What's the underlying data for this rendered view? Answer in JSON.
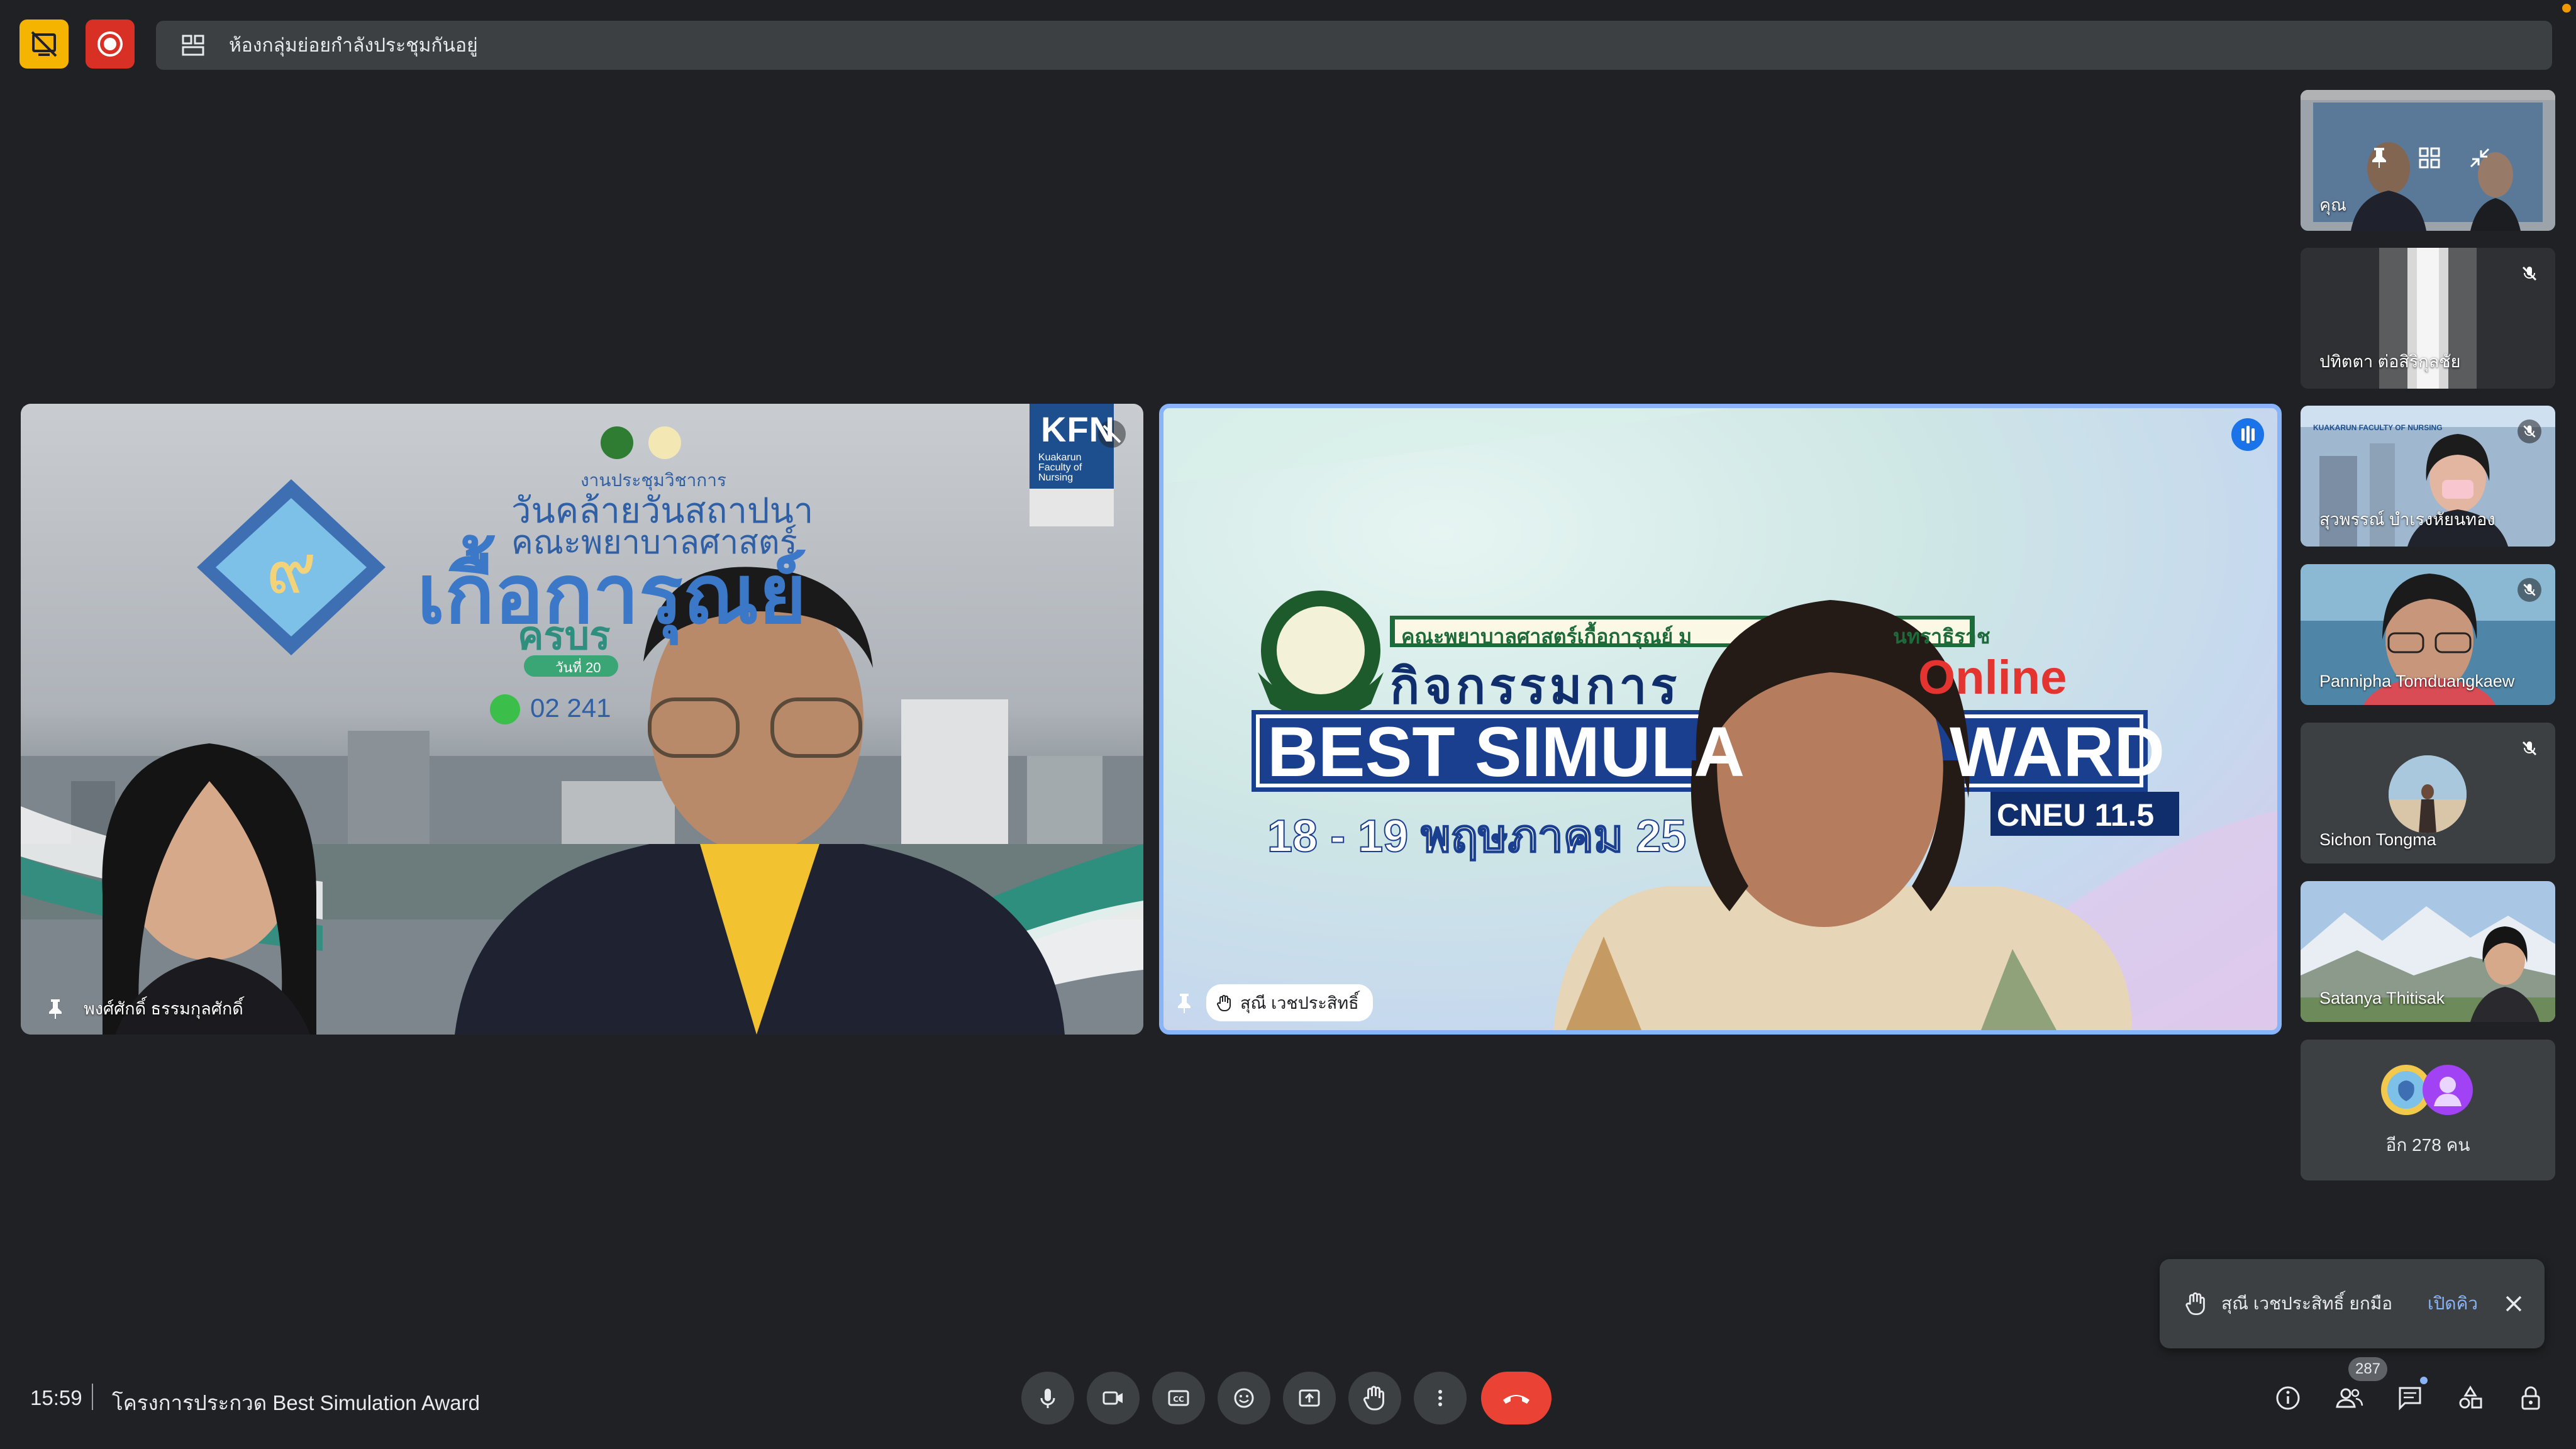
{
  "top_bar": {
    "breakout_notice": "ห้องกลุ่มย่อยกำลังประชุมกันอยู่"
  },
  "main_tiles": [
    {
      "participant_name": "พงศ์ศักดิ์ ธรรมกุลศักดิ์",
      "background": {
        "kfn_logo": "KFN",
        "kfn_sub": "Kuakarun Faculty of Nursing",
        "line1": "งานประชุมวิชาการ",
        "line2": "วันคล้ายวันสถาปนา",
        "line3": "คณะพยาบาลศาสตร์",
        "line4": "เกื้อการุณย์",
        "line5": "ครบร",
        "line6": "วันที่ 20",
        "phone": "02 241"
      }
    },
    {
      "participant_name": "สุณี เวชประสิทธิ์",
      "background": {
        "faculty": "คณะพยาบาลศาสตร์เกื้อการุณย์ ม",
        "faculty_tail": "นทราธิราช",
        "activity": "กิจกรรมการ",
        "online": "Online",
        "award": "BEST SIMULA",
        "award_tail": "WARD",
        "cneu": "CNEU 11.5",
        "date": "18 - 19 พฤษภาคม 25"
      }
    }
  ],
  "side_tiles": [
    {
      "name": "คุณ"
    },
    {
      "name": "ปทิตตา ต่อสิริกุลชัย"
    },
    {
      "name": "สุวพรรณ์ บำเรงหัยนทอง",
      "banner": "KUAKARUN FACULTY OF NURSING"
    },
    {
      "name": "Pannipha Tomduangkaew"
    },
    {
      "name": "Sichon Tongma"
    },
    {
      "name": "Satanya Thitisak"
    },
    {
      "name": "อีก 278 คน"
    }
  ],
  "toast": {
    "message": "สุณี เวชประสิทธิ์ ยกมือ",
    "action": "เปิดคิว"
  },
  "bottom_bar": {
    "time": "15:59",
    "meeting_title": "โครงการประกวด Best Simulation Award",
    "people_count": "287"
  },
  "colors": {
    "background": "#202124",
    "surface": "#3c4043",
    "accent_blue": "#8ab4f8",
    "end_call_red": "#ea4335",
    "record_red": "#d93025",
    "presentation_yellow": "#f5b400"
  }
}
